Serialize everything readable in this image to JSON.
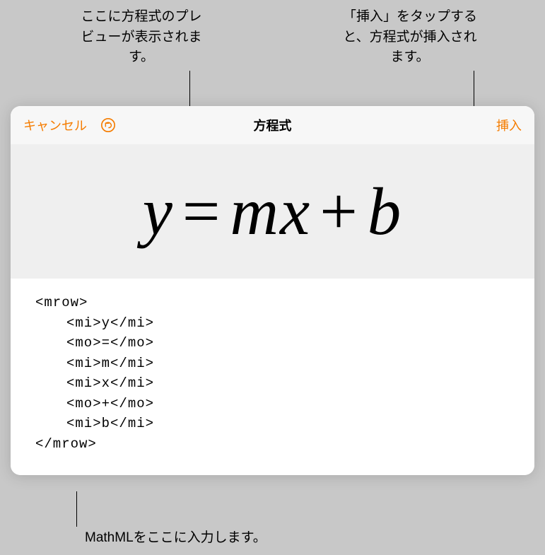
{
  "annotations": {
    "preview": "ここに方程式のプレビューが表示されます。",
    "insert": "「挿入」をタップすると、方程式が挿入されます。",
    "mathml": "MathMLをここに入力します。"
  },
  "dialog": {
    "cancel_label": "キャンセル",
    "title": "方程式",
    "insert_label": "挿入"
  },
  "equation": {
    "y": "y",
    "eq": "=",
    "m": "m",
    "x": "x",
    "plus": "+",
    "b": "b"
  },
  "code": {
    "open": "<mrow>",
    "l1": "<mi>y</mi>",
    "l2": "<mo>=</mo>",
    "l3": "<mi>m</mi>",
    "l4": "<mi>x</mi>",
    "l5": "<mo>+</mo>",
    "l6": "<mi>b</mi>",
    "close": "</mrow>"
  }
}
